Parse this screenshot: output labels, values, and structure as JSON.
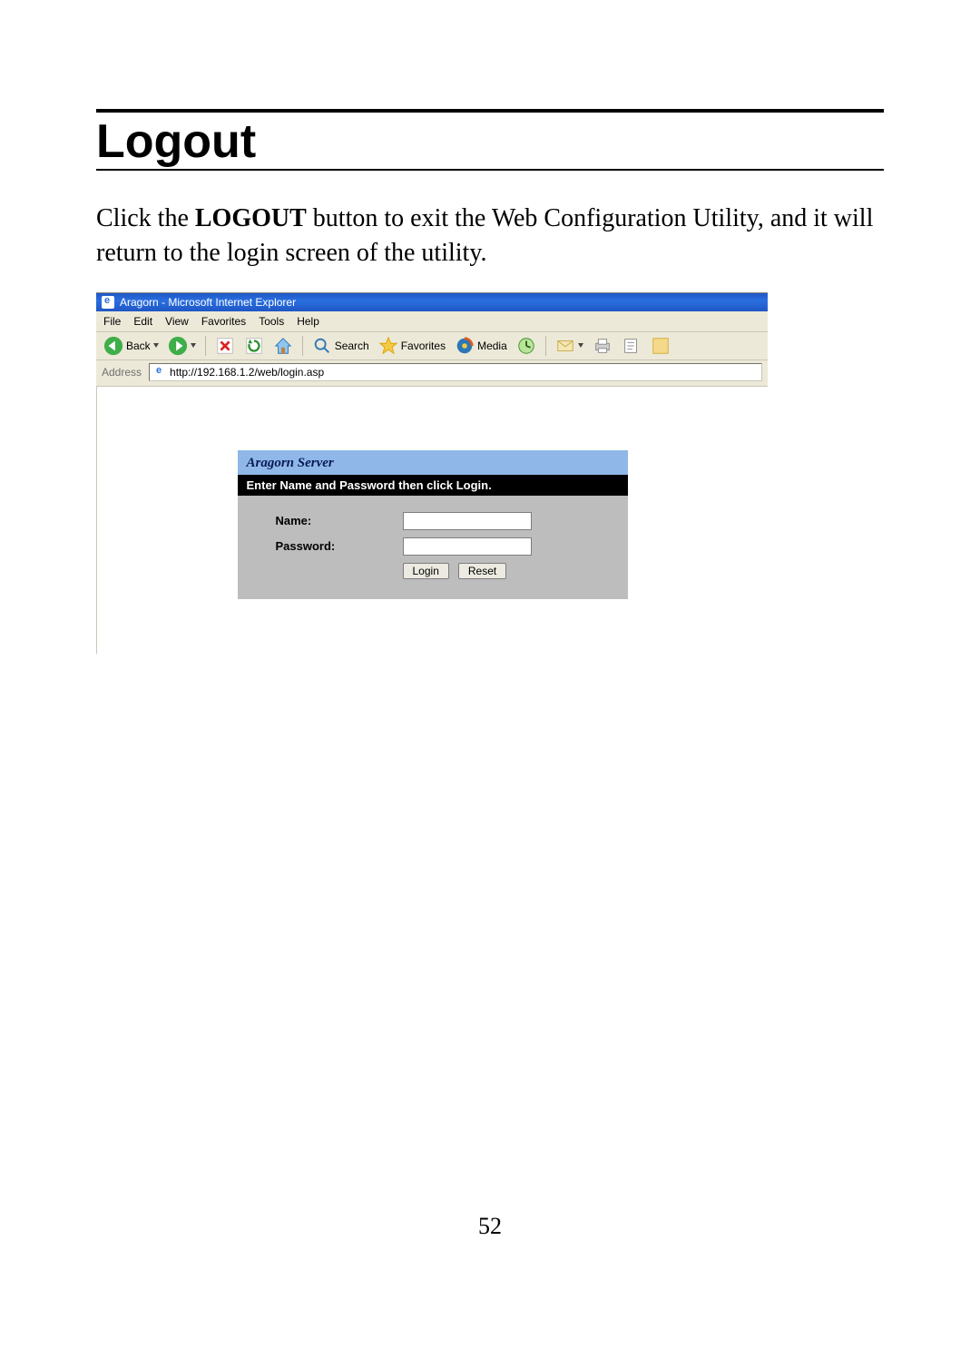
{
  "doc": {
    "heading": "Logout",
    "body_pre": "Click the ",
    "body_bold": "LOGOUT",
    "body_post": " button to exit the Web Configuration Utility, and it will return to the login screen of the utility.",
    "page_number": "52"
  },
  "browser": {
    "title": "Aragorn - Microsoft Internet Explorer",
    "menu": {
      "file": "File",
      "edit": "Edit",
      "view": "View",
      "favorites": "Favorites",
      "tools": "Tools",
      "help": "Help"
    },
    "toolbar": {
      "back": "Back",
      "search": "Search",
      "favorites": "Favorites",
      "media": "Media"
    },
    "address_label": "Address",
    "address_value": "http://192.168.1.2/web/login.asp"
  },
  "login": {
    "panel_title": "Aragorn Server",
    "instruction": "Enter Name and Password then click Login.",
    "name_label": "Name:",
    "password_label": "Password:",
    "name_value": "",
    "password_value": "",
    "login_btn": "Login",
    "reset_btn": "Reset"
  }
}
